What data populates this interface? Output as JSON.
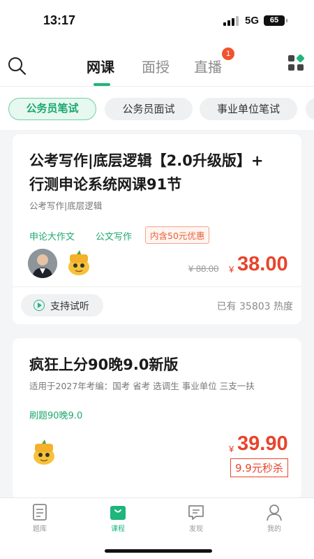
{
  "status_bar": {
    "time": "13:17",
    "network": "5G",
    "battery": "65"
  },
  "top_nav": {
    "tabs": [
      "网课",
      "面授",
      "直播"
    ],
    "active_tab": "网课",
    "live_badge": "1"
  },
  "categories": {
    "items": [
      "公务员笔试",
      "公务员面试",
      "事业单位笔试"
    ],
    "active": "公务员笔试"
  },
  "courses": [
    {
      "title_line1": "公考写作|底层逻辑【2.0升级版】+",
      "title_line2": "行测申论系统网课91节",
      "subtitle": "公考写作|底层逻辑",
      "tags": [
        "申论大作文",
        "公文写作"
      ],
      "promo": "内含50元优惠",
      "old_price": "¥ 88.00",
      "currency": "¥",
      "price": "38.00",
      "trial_label": "支持试听",
      "heat": "已有 35803 热度"
    },
    {
      "title": "疯狂上分90晚9.0新版",
      "subtitle": "适用于2027年考编：国考 省考 选调生 事业单位 三支一扶",
      "tags": [
        "刷题90晚9.0"
      ],
      "currency": "¥",
      "price": "39.90",
      "flash_sale": "9.9元秒杀"
    }
  ],
  "tab_bar": {
    "items": [
      "题库",
      "课程",
      "发现",
      "我的"
    ],
    "active": "课程"
  },
  "colors": {
    "brand_green": "#1fb57b",
    "price_red": "#e8442c",
    "badge_red": "#f0532f"
  }
}
